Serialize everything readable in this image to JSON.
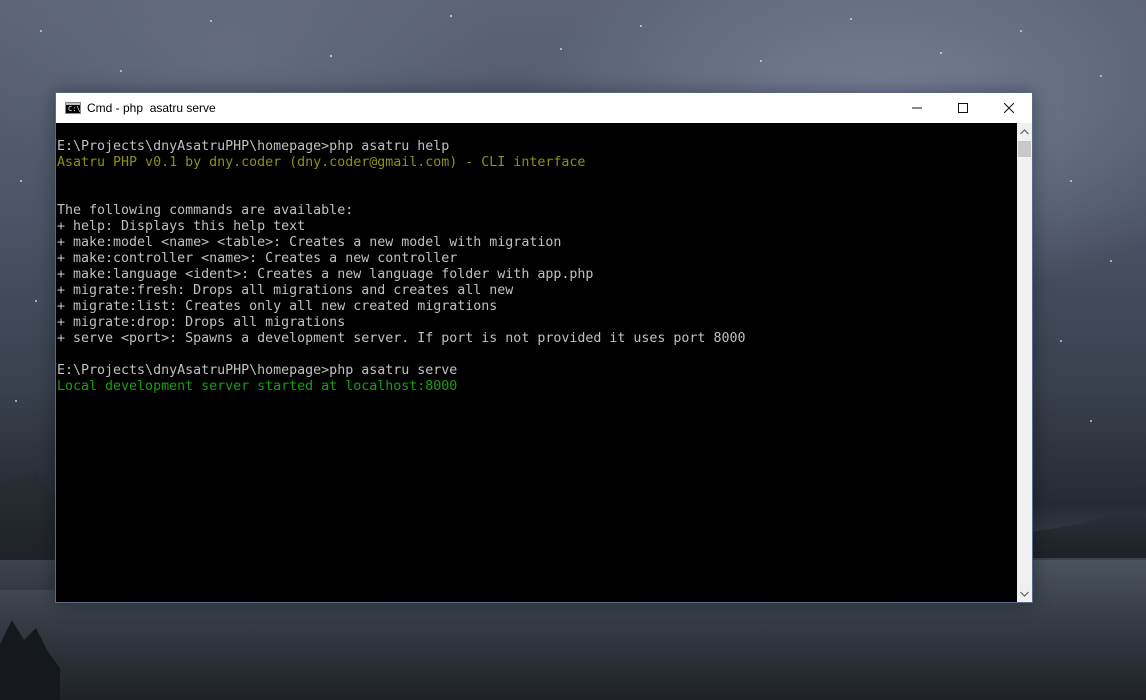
{
  "window": {
    "title": "Cmd - php  asatru serve",
    "icon": "cmd-icon"
  },
  "controls": {
    "minimize": "minimize-icon",
    "maximize": "maximize-icon",
    "close": "close-icon"
  },
  "console": {
    "lines": [
      {
        "text": "E:\\Projects\\dnyAsatruPHP\\homepage>php asatru help",
        "color": "#c0c0c0"
      },
      {
        "text": "Asatru PHP v0.1 by dny.coder (dny.coder@gmail.com) - CLI interface",
        "color": "#8f8f14"
      },
      {
        "text": "",
        "color": "#c0c0c0"
      },
      {
        "text": "",
        "color": "#c0c0c0"
      },
      {
        "text": "The following commands are available:",
        "color": "#c0c0c0"
      },
      {
        "text": "+ help: Displays this help text",
        "color": "#c0c0c0"
      },
      {
        "text": "+ make:model <name> <table>: Creates a new model with migration",
        "color": "#c0c0c0"
      },
      {
        "text": "+ make:controller <name>: Creates a new controller",
        "color": "#c0c0c0"
      },
      {
        "text": "+ make:language <ident>: Creates a new language folder with app.php",
        "color": "#c0c0c0"
      },
      {
        "text": "+ migrate:fresh: Drops all migrations and creates all new",
        "color": "#c0c0c0"
      },
      {
        "text": "+ migrate:list: Creates only all new created migrations",
        "color": "#c0c0c0"
      },
      {
        "text": "+ migrate:drop: Drops all migrations",
        "color": "#c0c0c0"
      },
      {
        "text": "+ serve <port>: Spawns a development server. If port is not provided it uses port 8000",
        "color": "#c0c0c0"
      },
      {
        "text": "",
        "color": "#c0c0c0"
      },
      {
        "text": "E:\\Projects\\dnyAsatruPHP\\homepage>php asatru serve",
        "color": "#c0c0c0"
      },
      {
        "text": "Local development server started at localhost:8000",
        "color": "#13a10e"
      }
    ]
  },
  "scrollbar": {
    "up": "chevron-up-icon",
    "down": "chevron-down-icon"
  },
  "colors": {
    "console_bg": "#000000",
    "titlebar_bg": "#ffffff",
    "text_default": "#c0c0c0",
    "text_yellow": "#8f8f14",
    "text_green": "#13a10e"
  }
}
